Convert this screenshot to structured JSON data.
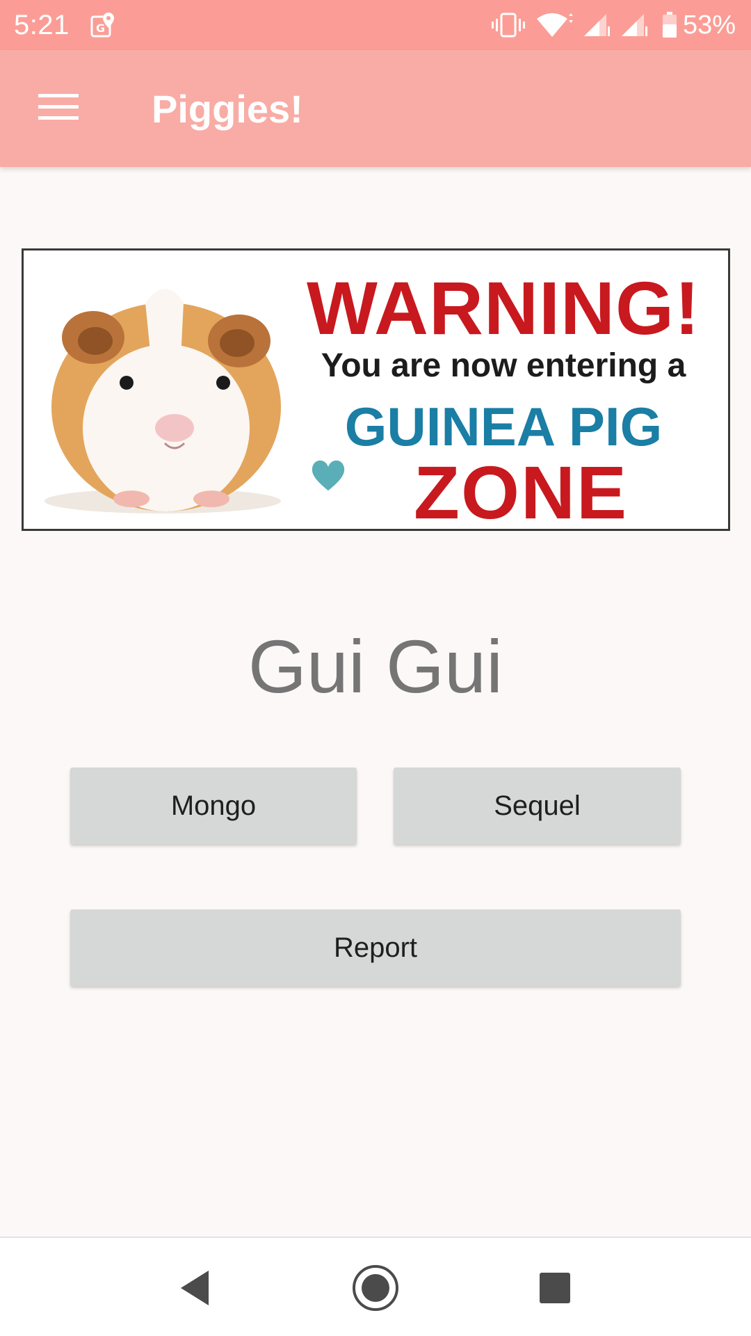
{
  "status_bar": {
    "time": "5:21",
    "battery": "53%",
    "icons": [
      "maps-notification-icon",
      "vibrate-icon",
      "wifi-icon",
      "signal-icon",
      "signal-icon",
      "battery-icon"
    ],
    "background": "#fb9d96"
  },
  "app_bar": {
    "title": "Piggies!",
    "menu_icon": "hamburger-menu-icon",
    "background": "#f8aca5"
  },
  "banner": {
    "headline": "WARNING!",
    "line": "You are now entering a",
    "subject": "GUINEA PIG",
    "zone": "ZONE",
    "headline_color": "#c8191f",
    "subject_color": "#1a7ea5"
  },
  "main": {
    "name": "Gui Gui",
    "buttons": {
      "mongo": "Mongo",
      "sequel": "Sequel",
      "report": "Report"
    }
  },
  "nav_bar": {
    "icons": [
      "back-icon",
      "home-icon",
      "recents-icon"
    ]
  }
}
